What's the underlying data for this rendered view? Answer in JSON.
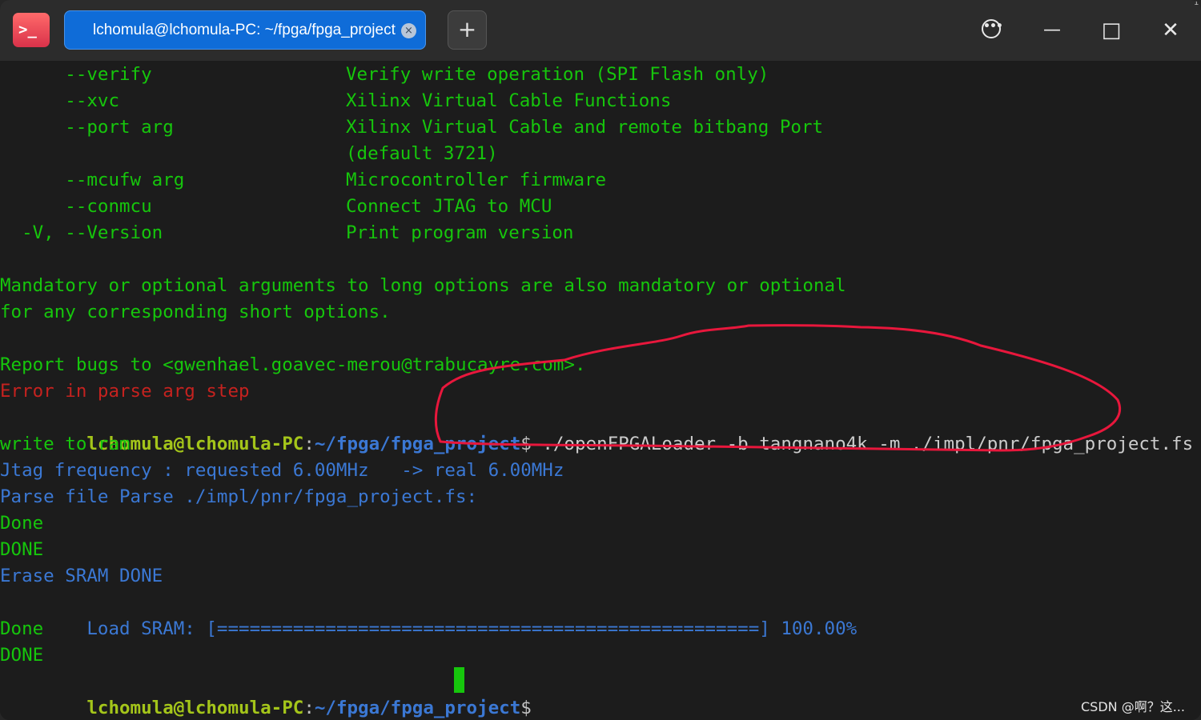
{
  "window": {
    "tab_title": "lchomula@lchomula-PC: ~/fpga/fpga_project",
    "tab_close_glyph": "×",
    "new_tab_glyph": "+",
    "app_icon_glyph": ">_",
    "more_glyph": "•••",
    "minimize_glyph": "—",
    "maximize_glyph": "□",
    "close_glyph": "✕",
    "colors": {
      "titlebar": "#2c2c2c",
      "tab_active": "#0f6cd8",
      "terminal_bg": "#1c1c1c",
      "green": "#16c60c",
      "red": "#c5221f",
      "blue": "#3b78d4",
      "prompt_user": "#a4c51a",
      "annotation": "#e8173c"
    }
  },
  "terminal": {
    "help_options": [
      {
        "option": "      --verify",
        "desc": "Verify write operation (SPI Flash only)"
      },
      {
        "option": "      --xvc",
        "desc": "Xilinx Virtual Cable Functions"
      },
      {
        "option": "      --port arg",
        "desc": "Xilinx Virtual Cable and remote bitbang Port"
      },
      {
        "option": "",
        "desc": "(default 3721)"
      },
      {
        "option": "      --mcufw arg",
        "desc": "Microcontroller firmware"
      },
      {
        "option": "      --conmcu",
        "desc": "Connect JTAG to MCU"
      },
      {
        "option": "  -V, --Version",
        "desc": "Print program version"
      }
    ],
    "mandatory_line1": "Mandatory or optional arguments to long options are also mandatory or optional",
    "mandatory_line2": "for any corresponding short options.",
    "report_bugs": "Report bugs to <gwenhael.goavec-merou@trabucayre.com>.",
    "error_line": "Error in parse arg step",
    "prompt_user": "lchomula@lchomula-PC",
    "prompt_sep": ":",
    "prompt_path": "~/fpga/fpga_project",
    "prompt_dollar": "$",
    "command": " ./openFPGALoader -b tangnano4k -m ./impl/pnr/fpga_project.fs",
    "output": {
      "write_to_ram": "write to ram",
      "jtag_freq": "Jtag frequency : requested 6.00MHz   -> real 6.00MHz",
      "parse_file": "Parse file Parse ./impl/pnr/fpga_project.fs:",
      "done1": "Done",
      "done_caps1": "DONE",
      "erase_sram": "Erase SRAM DONE",
      "load_sram_label": "Load SRAM: ",
      "load_sram_bar": "[==================================================]",
      "load_sram_percent": " 100.00%",
      "load_sram_progress": 1.0,
      "done2": "Done",
      "done_caps2": "DONE"
    }
  },
  "watermark": "CSDN @啊？这...",
  "corner_marker": "1"
}
